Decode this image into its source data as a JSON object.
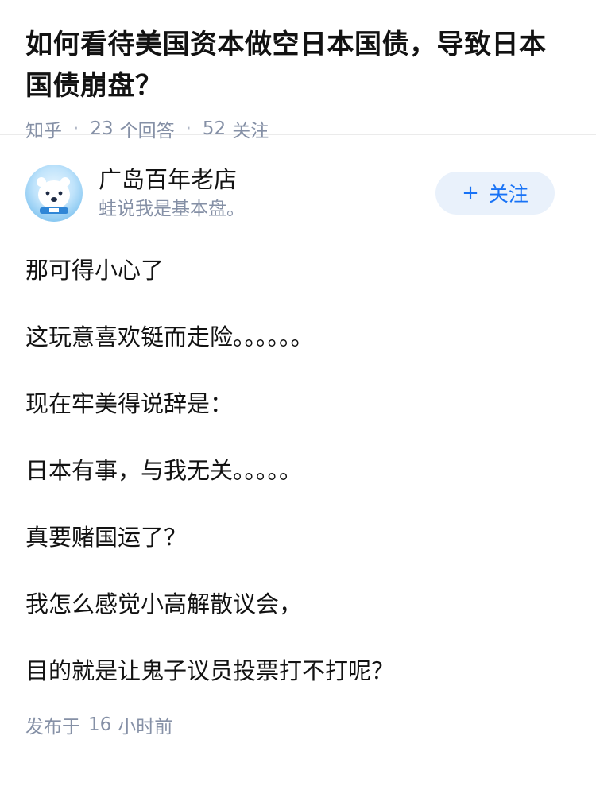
{
  "question": {
    "title": "如何看待美国资本做空日本国债，导致日本国债崩盘？",
    "source": "知乎",
    "answer_count": "23",
    "answer_label": "个回答",
    "follow_count": "52",
    "follow_label": "关注"
  },
  "answer": {
    "author": {
      "name": "广岛百年老店",
      "bio": "蛙说我是基本盘。",
      "avatar_icon": "polar-bear-avatar-icon"
    },
    "follow_button": {
      "icon": "plus-icon",
      "plus": "+",
      "label": "关注"
    },
    "paragraphs": [
      "那可得小心了",
      "这玩意喜欢铤而走险。。。。。。",
      "现在牢美得说辞是：",
      "日本有事，与我无关。。。。。",
      "真要赌国运了？",
      "我怎么感觉小高解散议会，",
      "目的就是让鬼子议员投票打不打呢？"
    ],
    "published_prefix": "发布于",
    "published_num": "16",
    "published_suffix": "小时前"
  },
  "colors": {
    "text": "#121212",
    "meta": "#8590a6",
    "accent": "#1772f6",
    "button_bg": "#e9f1fb"
  }
}
